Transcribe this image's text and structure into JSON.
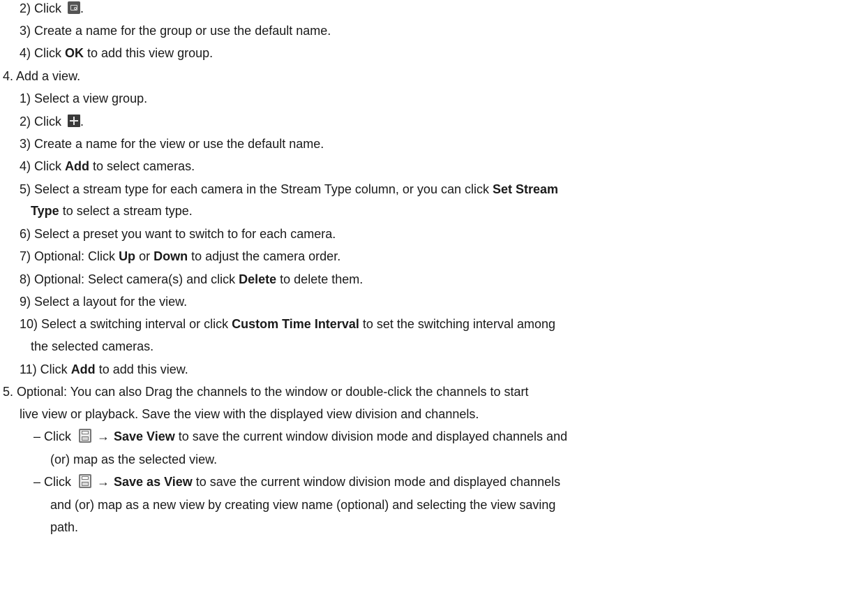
{
  "steps": {
    "s3_2": {
      "pre": "2) Click ",
      "post": "."
    },
    "s3_3": {
      "text": "3) Create a name for the group or use the default name."
    },
    "s3_4": {
      "pre": "4) Click ",
      "bold": "OK",
      "post": " to add this view group."
    },
    "s4": {
      "text": "4. Add a view."
    },
    "s4_1": {
      "text": "1) Select a view group."
    },
    "s4_2": {
      "pre": "2) Click ",
      "post": "."
    },
    "s4_3": {
      "text": "3) Create a name for the view or use the default name."
    },
    "s4_4": {
      "pre": "4) Click ",
      "bold": "Add",
      "post": " to select cameras."
    },
    "s4_5": {
      "pre": "5) Select a stream type for each camera in the Stream Type column, or you can click ",
      "bold": "Set Stream",
      "bold2": "Type",
      "post": " to select a stream type."
    },
    "s4_6": {
      "text": "6) Select a preset you want to switch to for each camera."
    },
    "s4_7": {
      "pre": "7) Optional: Click ",
      "bold": "Up",
      "mid": " or ",
      "bold2": "Down",
      "post": " to adjust the camera order."
    },
    "s4_8": {
      "pre": "8) Optional: Select camera(s) and click ",
      "bold": "Delete",
      "post": " to delete them."
    },
    "s4_9": {
      "text": "9) Select a layout for the view."
    },
    "s4_10": {
      "pre": "10) Select a switching interval or click ",
      "bold": "Custom Time Interval",
      "post": " to set the switching interval among",
      "cont": "the selected cameras."
    },
    "s4_11": {
      "pre": "11) Click ",
      "bold": "Add",
      "post": " to add this view."
    },
    "s5": {
      "line1": "5. Optional: You can also Drag the channels to the window or double-click the channels to start",
      "line2": "live view or playback. Save the view with the displayed view division and channels."
    },
    "b1": {
      "pre": "– Click ",
      "arrow": "→",
      "bold": "Save View",
      "post": " to save the current window division mode and displayed channels and",
      "cont": "(or) map as the selected view."
    },
    "b2": {
      "pre": "– Click ",
      "arrow": "→",
      "bold": "Save as View",
      "post": " to save the current window division mode and displayed channels",
      "cont1": "and (or) map as a new view by creating view name (optional) and selecting the view saving",
      "cont2": "path."
    }
  },
  "icons": {
    "group": "add-view-group-icon",
    "view": "add-view-plus-icon",
    "save": "save-disk-icon"
  }
}
